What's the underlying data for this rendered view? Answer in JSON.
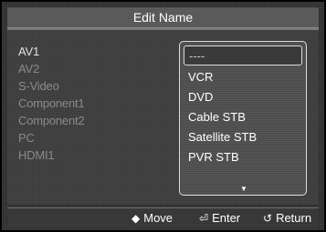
{
  "title": "Edit Name",
  "sources": [
    {
      "label": "AV1",
      "selected": true
    },
    {
      "label": "AV2",
      "selected": false
    },
    {
      "label": "S-Video",
      "selected": false
    },
    {
      "label": "Component1",
      "selected": false
    },
    {
      "label": "Component2",
      "selected": false
    },
    {
      "label": "PC",
      "selected": false
    },
    {
      "label": "HDMI1",
      "selected": false
    }
  ],
  "right_marks": [
    "",
    "",
    "",
    "",
    "",
    "",
    ""
  ],
  "dropdown": {
    "options": [
      "----",
      "VCR",
      "DVD",
      "Cable STB",
      "Satellite STB",
      "PVR STB"
    ],
    "focused_index": 0,
    "more_indicator": "▼"
  },
  "footer": {
    "move": {
      "icon": "up-down-arrows-icon",
      "glyph": "◆",
      "label": "Move"
    },
    "enter": {
      "icon": "enter-icon",
      "glyph": "⏎",
      "label": "Enter"
    },
    "return": {
      "icon": "return-icon",
      "glyph": "↺",
      "label": "Return"
    }
  }
}
